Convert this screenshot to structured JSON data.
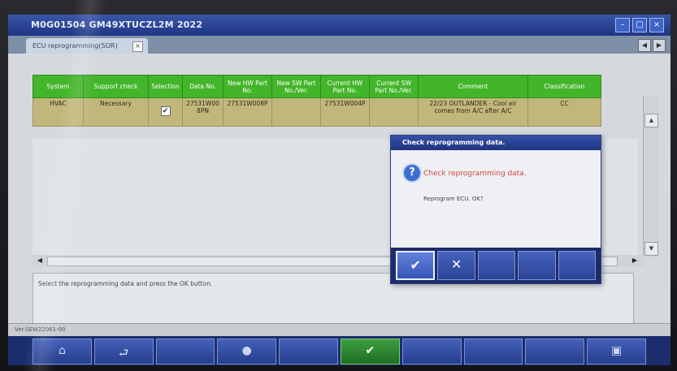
{
  "window": {
    "title": "M0G01504 GM49XTUCZL2M 2022"
  },
  "tabs": [
    {
      "label": "ECU reprogramming(SOR)"
    }
  ],
  "table": {
    "columns": [
      "System",
      "Support check",
      "Selection",
      "Data No.",
      "New HW Part No.",
      "New SW Part No./Ver.",
      "Current HW Part No.",
      "Current SW Part No./Ver.",
      "Comment",
      "Classification"
    ],
    "rows": [
      {
        "system": "HVAC",
        "support_check": "Necessary",
        "selected": true,
        "data_no": "27531W00 8PN",
        "new_hw": "27531W008P",
        "new_sw": "",
        "current_hw": "27531W004P",
        "current_sw": "",
        "comment": "22/23 OUTLANDER - Cool air comes from A/C after A/C",
        "classification": "CC"
      }
    ]
  },
  "message": "Select the reprogramming data and press the OK button.",
  "status_text": "Ver.SEW22061-00",
  "dialog": {
    "title": "Check reprogramming data.",
    "heading": "Check reprogramming data.",
    "body": "Reprogram ECU. OK?"
  },
  "colors": {
    "header_green": "#43b52a",
    "row_highlight": "#c2b77a",
    "toolbar_blue": "#1b2d6d",
    "dialog_heading_red": "#d6463c"
  }
}
